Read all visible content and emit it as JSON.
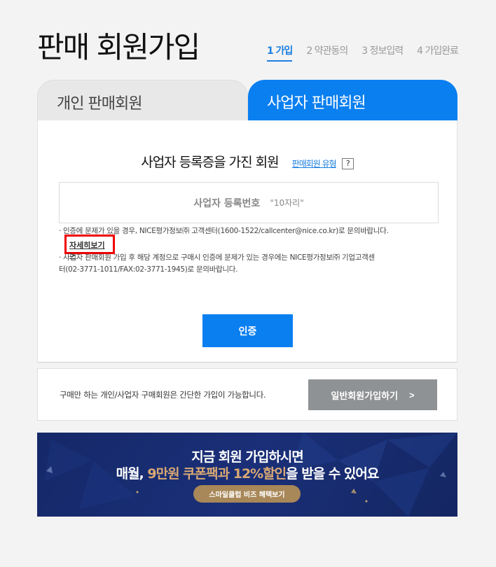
{
  "page": {
    "title": "판매 회원가입"
  },
  "steps": [
    {
      "label": "1 가입",
      "active": true
    },
    {
      "label": "2 약관동의",
      "active": false
    },
    {
      "label": "3 정보입력",
      "active": false
    },
    {
      "label": "4 가입완료",
      "active": false
    }
  ],
  "tabs": {
    "individual": "개인 판매회원",
    "business": "사업자 판매회원"
  },
  "panel": {
    "heading": "사업자 등록증을 가진 회원",
    "type_link": "판매회원 유형",
    "help": "?",
    "input_label": "사업자 등록번호",
    "input_hint": "\"10자리\"",
    "notice1": "인증에 문제가 있을 경우, NICE평가정보㈜ 고객센터(1600-1522/callcenter@nice.co.kr)로 문의바랍니다.",
    "detail_link": "자세히보기 >",
    "notice2": "사업자 판매회원 가입 후 해당 계정으로 구매시 인증에 문제가 있는 경우에는 NICE평가정보㈜ 기업고객센터(02-3771-1011/FAX:02-3771-1945)로 문의바랍니다.",
    "verify_button": "인증",
    "bullet": "·"
  },
  "general": {
    "description": "구매만 하는 개인/사업자 구매회원은 간단한 가입이 가능합니다.",
    "button": "일반회원가입하기",
    "button_arrow": ">"
  },
  "banner": {
    "line1": "지금 회원 가입하시면",
    "line2_pre": "매월, ",
    "line2_hl": "9만원 쿠폰팩과 12%할인",
    "line2_post": "을 받을 수 있어요",
    "button": "스마일클럽 비즈 혜택보기"
  },
  "colors": {
    "accent": "#0a7ff0",
    "banner_bg": "#152868",
    "highlight": "#d9a873",
    "error_box": "#ee0000"
  }
}
